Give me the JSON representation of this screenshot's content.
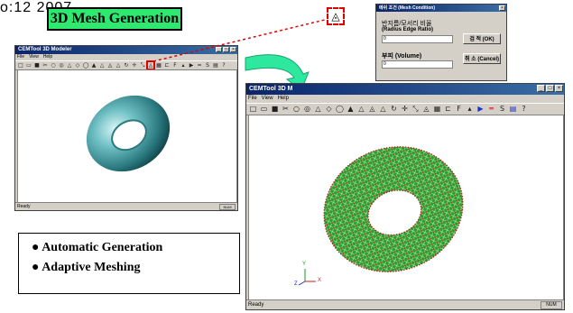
{
  "date_fragment": "o:12  2007",
  "banner": {
    "title": "3D Mesh Generation"
  },
  "small_window": {
    "title": "CEMTool 3D Modeler",
    "menus": [
      "File",
      "View",
      "Help"
    ],
    "status": "Ready",
    "status_num": "NUM"
  },
  "large_window": {
    "title": "CEMTool 3D M",
    "menus": [
      "File",
      "View",
      "Help"
    ],
    "status": "Ready",
    "status_num": "NUM",
    "axis_labels": {
      "y": "Y",
      "z": "Z",
      "x": "X"
    }
  },
  "dialog": {
    "title": "메쉬 조건 (Mesh Condition)",
    "radius_label_ko": "반지름/모서리 비율",
    "radius_label_en": "(Radius Edge Ratio)",
    "radius_value": "0",
    "volume_label": "부피 (Volume)",
    "volume_value": "0",
    "ok_label": "검 적 (OK)",
    "cancel_label": "취 소 (Cancel)"
  },
  "features": [
    "Automatic Generation",
    "Adaptive Meshing"
  ],
  "colors": {
    "banner": "#2ee86f",
    "arrow": "#2ee8a0",
    "torus_solid": "#3a8f94",
    "mesh": "#1f8a1f",
    "highlight": "#e00000"
  }
}
